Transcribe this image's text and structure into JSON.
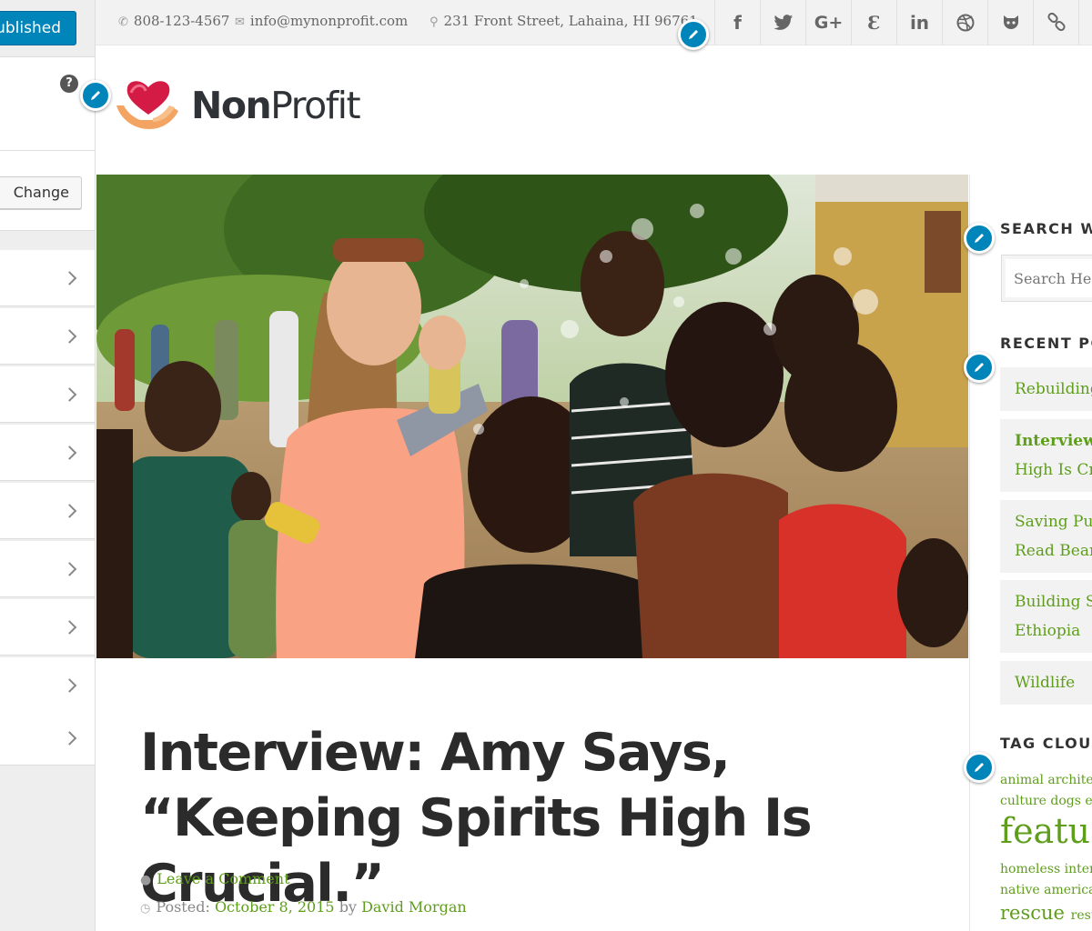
{
  "customizer": {
    "publish_label": "Published",
    "change_label": "Change"
  },
  "topbar": {
    "phone": "808-123-4567",
    "email": "info@mynonprofit.com",
    "address": "231 Front Street, Lahaina, HI 96761",
    "social": [
      "facebook",
      "twitter",
      "google-plus",
      "pinterest",
      "linkedin",
      "dribbble",
      "github",
      "link"
    ]
  },
  "logo": {
    "bold": "Non",
    "rest": "Profit"
  },
  "post": {
    "title_bold": "Interview:",
    "title_rest": " Amy Says, “Keeping Spirits High Is Crucial.”",
    "comment_link": "Leave a Comment",
    "posted_label": "Posted:",
    "date": "October 8, 2015",
    "by": "by",
    "author": "David Morgan"
  },
  "sidebar": {
    "search_title": "SEARCH W",
    "search_placeholder": "Search He",
    "recent_title": "RECENT PC",
    "recent_posts": [
      {
        "l1": "Rebuilding"
      },
      {
        "l1": "Interview",
        "l2": "High Is Cru"
      },
      {
        "l1": "Saving Pup",
        "l2": "Read Bear"
      },
      {
        "l1": "Building S",
        "l2": "Ethiopia"
      },
      {
        "l1": "Wildlife"
      }
    ],
    "tag_title": "TAG CLOUD",
    "tags_line1": "animal archite",
    "tags_line2": "culture dogs el",
    "tags_big": "featu",
    "tags_line4": "homeless inter",
    "tags_line5": "native america",
    "tags_rescue": "rescue",
    "tags_rest": "rest"
  },
  "colors": {
    "accent_green": "#5f9d1c",
    "customizer_blue": "#0085ba"
  }
}
